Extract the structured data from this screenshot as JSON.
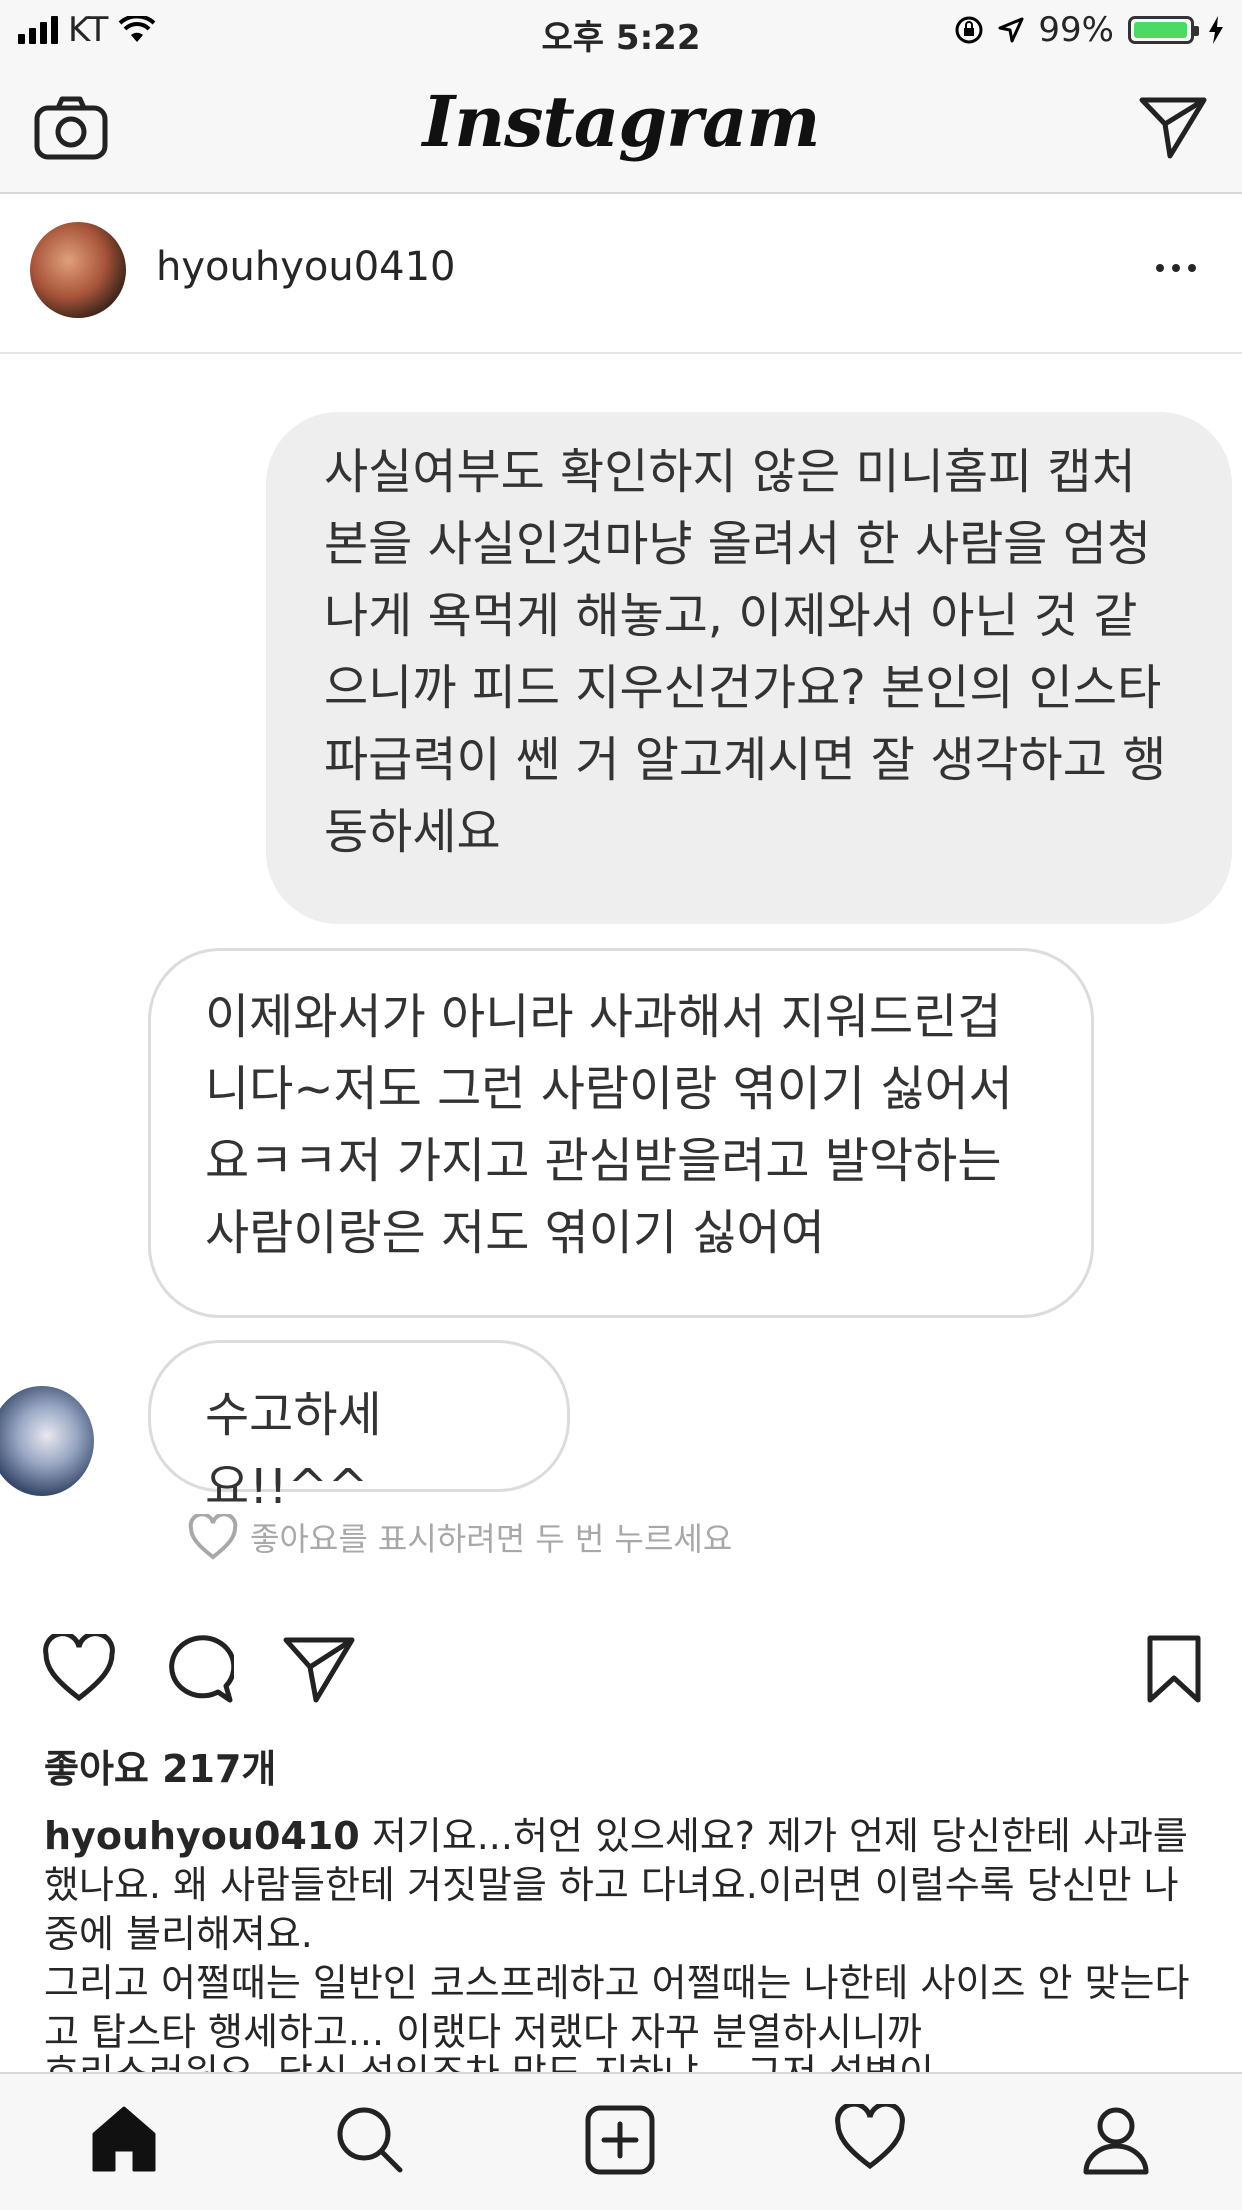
{
  "status_bar": {
    "carrier": "KT",
    "time": "오후 5:22",
    "battery": "99%",
    "battery_level": 0.99,
    "battery_color": "#4cd964"
  },
  "header": {
    "logo": "Instagram",
    "left_icon": "camera-icon",
    "right_icon": "direct-send-icon"
  },
  "post": {
    "username": "hyouhyou0410",
    "menu_icon": "more-dots-icon"
  },
  "dm_screenshot": {
    "message_1": "사실여부도 확인하지 않은 미니홈피 캡처본을 사실인것마냥 올려서 한 사람을 엄청나게 욕먹게 해놓고, 이제와서 아닌 것 같으니까 피드 지우신건가요? 본인의 인스타 파급력이 쎈 거 알고계시면 잘 생각하고 행동하세요",
    "message_2": "이제와서가 아니라 사과해서 지워드린겁니다~저도 그런 사람이랑 엮이기 싫어서요ㅋㅋ저 가지고 관심받을려고 발악하는 사람이랑은 저도 엮이기 싫어여",
    "message_3": "수고하세요!!^^",
    "like_hint": "좋아요를 표시하려면 두 번 누르세요"
  },
  "actions": {
    "likes": "좋아요 217개"
  },
  "caption": {
    "username": "hyouhyou0410",
    "text": "저기요...허언 있으세요? 제가 언제 당신한테 사과를 했나요. 왜 사람들한테 거짓말을 하고 다녀요.이러면 이럴수록 당신만 나중에 불리해져요.",
    "text_2": "그리고 어쩔때는 일반인 코스프레하고 어쩔때는 나한테 사이즈 안 맞는다고 탑스타 행세하고... 이랬다 저랬다 자꾸 분열하시니까",
    "text_cut": "흐리스러워요. 당신 성인조차 맞도 지하냐... 그저 설병이..."
  },
  "tab_bar": {
    "items": [
      "home-icon",
      "search-icon",
      "add-post-icon",
      "activity-heart-icon",
      "profile-icon"
    ]
  }
}
